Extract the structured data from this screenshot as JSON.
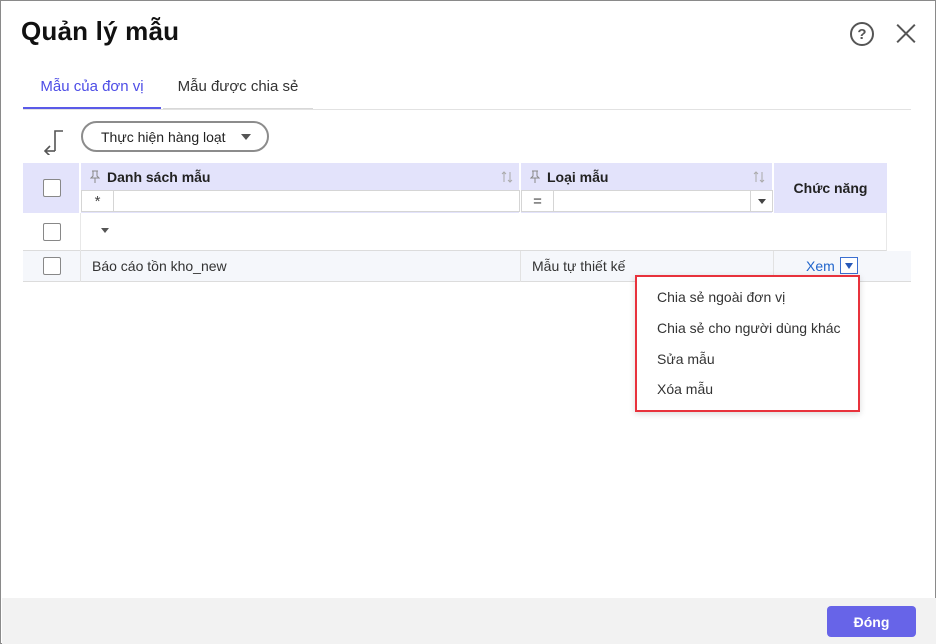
{
  "dialog": {
    "title": "Quản lý mẫu",
    "help_icon": "question-circle-icon",
    "close_icon": "close-icon"
  },
  "tabs": [
    {
      "label": "Mẫu của đơn vị",
      "active": true
    },
    {
      "label": "Mẫu được chia sẻ",
      "active": false
    }
  ],
  "toolbar": {
    "collapse_icon": "arrow-down-left-icon",
    "bulk_action_label": "Thực hiện hàng loạt"
  },
  "table": {
    "columns": [
      {
        "label": "Danh sách mẫu",
        "filter_operator": "*",
        "filter_value": ""
      },
      {
        "label": "Loại mẫu",
        "filter_operator": "=",
        "filter_value": ""
      },
      {
        "label": "Chức năng"
      }
    ],
    "rows": [
      {
        "name": "Báo cáo tồn kho_new",
        "type": "Mẫu tự thiết kế",
        "action": "Xem"
      }
    ]
  },
  "action_menu": {
    "items": [
      "Chia sẻ ngoài đơn vị",
      "Chia sẻ cho người dùng khác",
      "Sửa mẫu",
      "Xóa mẫu"
    ],
    "highlight_color": "#e8323c"
  },
  "footer": {
    "close_label": "Đóng"
  },
  "colors": {
    "accent": "#6764e8",
    "header_bg": "#e3e3fb",
    "link": "#2266cc"
  }
}
